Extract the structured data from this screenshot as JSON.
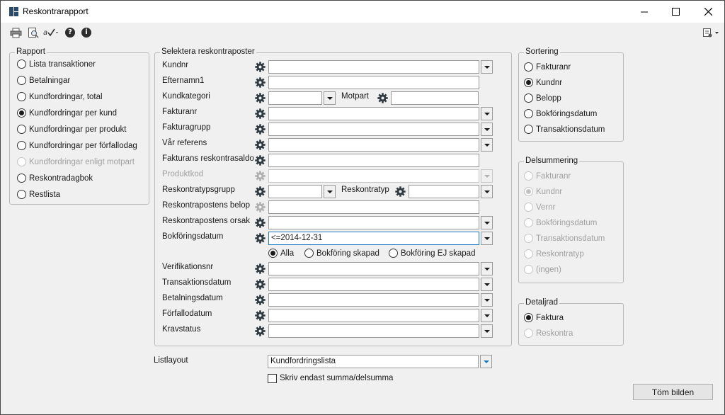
{
  "window": {
    "title": "Reskontrarapport",
    "controls": {
      "minimize": "—",
      "maximize": "☐",
      "close": "✕"
    }
  },
  "toolbar": {
    "icons": [
      "printer-icon",
      "print-preview-icon",
      "spell-check-icon",
      "help-icon",
      "info-icon",
      "settings-menu-icon"
    ],
    "help_glyph": "?",
    "info_glyph": "i"
  },
  "rapport": {
    "legend": "Rapport",
    "options": [
      {
        "label": "Lista transaktioner",
        "checked": false,
        "disabled": false
      },
      {
        "label": "Betalningar",
        "checked": false,
        "disabled": false
      },
      {
        "label": "Kundfordringar, total",
        "checked": false,
        "disabled": false
      },
      {
        "label": "Kundfordringar per kund",
        "checked": true,
        "disabled": false
      },
      {
        "label": "Kundfordringar per produkt",
        "checked": false,
        "disabled": false
      },
      {
        "label": "Kundfordringar per förfallodag",
        "checked": false,
        "disabled": false
      },
      {
        "label": "Kundfordringar enligt motpart",
        "checked": false,
        "disabled": true
      },
      {
        "label": "Reskontradagbok",
        "checked": false,
        "disabled": false
      },
      {
        "label": "Restlista",
        "checked": false,
        "disabled": false
      }
    ]
  },
  "selection": {
    "legend": "Selektera reskontraposter",
    "rows": [
      {
        "label": "Kundnr",
        "value": "",
        "dropdown": true,
        "disabled": false
      },
      {
        "label": "Efternamn1",
        "value": "",
        "dropdown": false,
        "disabled": false
      },
      {
        "label": "Kundkategori",
        "value": "",
        "dropdown": true,
        "disabled": false,
        "split": {
          "label": "Motpart",
          "value": ""
        }
      },
      {
        "label": "Fakturanr",
        "value": "",
        "dropdown": true,
        "disabled": false
      },
      {
        "label": "Fakturagrupp",
        "value": "",
        "dropdown": true,
        "disabled": false
      },
      {
        "label": "Vår referens",
        "value": "",
        "dropdown": true,
        "disabled": false
      },
      {
        "label": "Fakturans reskontrasaldo",
        "value": "",
        "dropdown": false,
        "disabled": false
      },
      {
        "label": "Produktkod",
        "value": "",
        "dropdown": true,
        "disabled": true
      },
      {
        "label": "Reskontratypsgrupp",
        "value": "",
        "dropdown": true,
        "disabled": false,
        "split": {
          "label": "Reskontratyp",
          "value": ""
        }
      },
      {
        "label": "Reskontrapostens belop",
        "value": "",
        "dropdown": false,
        "disabled": false,
        "gear_disabled": true
      },
      {
        "label": "Reskontrapostens orsak",
        "value": "",
        "dropdown": true,
        "disabled": false
      },
      {
        "label": "Bokföringsdatum",
        "value": "<=2014-12-31",
        "dropdown": true,
        "disabled": false,
        "focused": true
      }
    ],
    "booking_options": [
      {
        "label": "Alla",
        "checked": true
      },
      {
        "label": "Bokföring skapad",
        "checked": false
      },
      {
        "label": "Bokföring EJ skapad",
        "checked": false
      }
    ],
    "rows2": [
      {
        "label": "Verifikationsnr",
        "value": "",
        "dropdown": true
      },
      {
        "label": "Transaktionsdatum",
        "value": "",
        "dropdown": true
      },
      {
        "label": "Betalningsdatum",
        "value": "",
        "dropdown": true
      },
      {
        "label": "Förfallodatum",
        "value": "",
        "dropdown": true
      },
      {
        "label": "Kravstatus",
        "value": "",
        "dropdown": true
      }
    ]
  },
  "sortering": {
    "legend": "Sortering",
    "options": [
      {
        "label": "Fakturanr",
        "checked": false
      },
      {
        "label": "Kundnr",
        "checked": true
      },
      {
        "label": "Belopp",
        "checked": false
      },
      {
        "label": "Bokföringsdatum",
        "checked": false
      },
      {
        "label": "Transaktionsdatum",
        "checked": false
      }
    ]
  },
  "delsummering": {
    "legend": "Delsummering",
    "options": [
      {
        "label": "Fakturanr",
        "checked": false
      },
      {
        "label": "Kundnr",
        "checked": true
      },
      {
        "label": "Vernr",
        "checked": false
      },
      {
        "label": "Bokföringsdatum",
        "checked": false
      },
      {
        "label": "Transaktionsdatum",
        "checked": false
      },
      {
        "label": "Reskontratyp",
        "checked": false
      },
      {
        "label": "(ingen)",
        "checked": false
      }
    ]
  },
  "detaljrad": {
    "legend": "Detaljrad",
    "options": [
      {
        "label": "Faktura",
        "checked": true,
        "disabled": false
      },
      {
        "label": "Reskontra",
        "checked": false,
        "disabled": true
      }
    ]
  },
  "listlayout": {
    "label": "Listlayout",
    "value": "Kundfordringslista",
    "checkbox_label": "Skriv endast summa/delsumma",
    "checkbox_checked": false
  },
  "buttons": {
    "clear": "Töm bilden"
  },
  "colors": {
    "focus": "#1c7bc4",
    "disabled_text": "#a0a0a0"
  }
}
